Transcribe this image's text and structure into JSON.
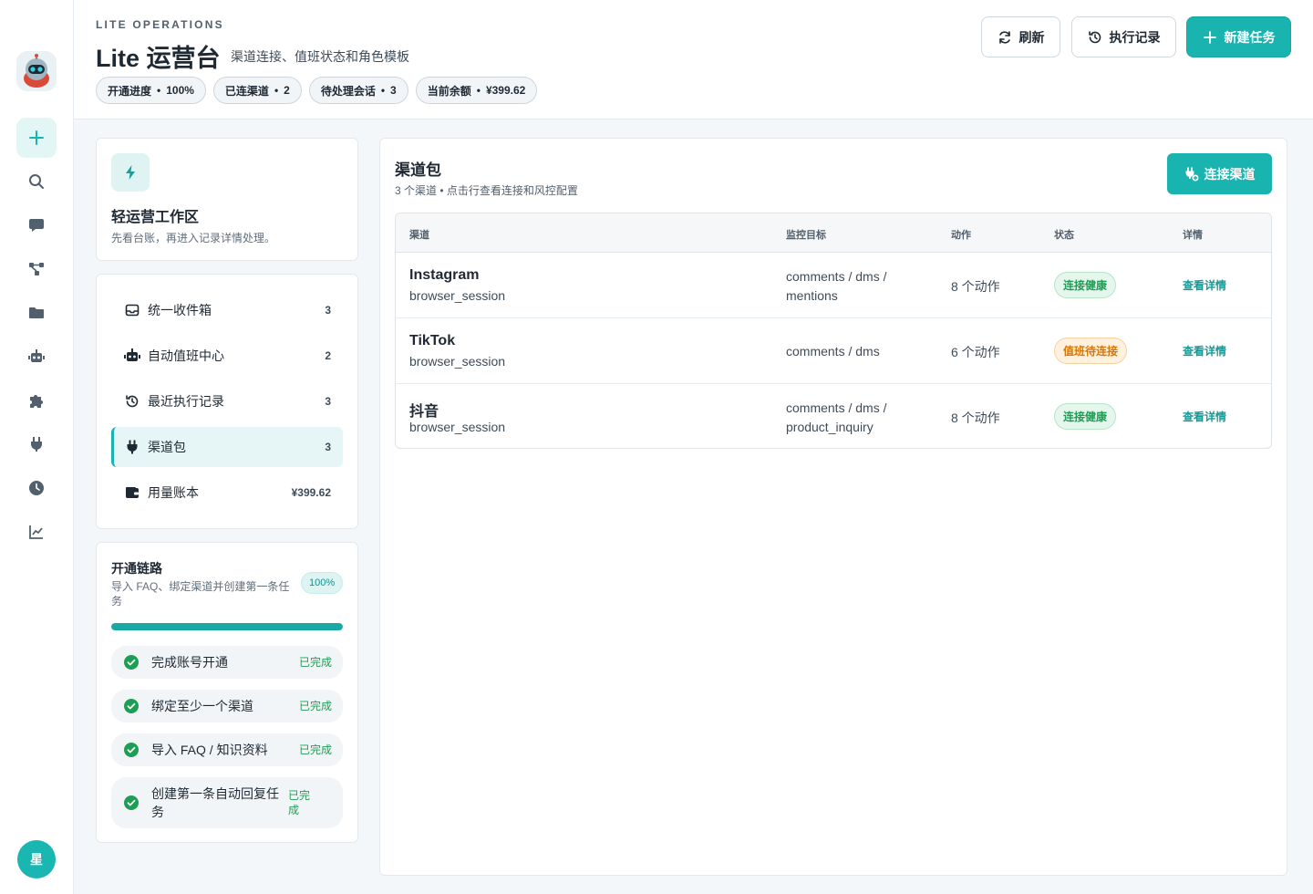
{
  "rail": {
    "icons": [
      "robot-logo",
      "plus-icon",
      "search-icon",
      "chat-icon",
      "flow-icon",
      "folder-icon",
      "bot-icon",
      "puzzle-icon",
      "plug-icon",
      "clock-icon",
      "chart-icon"
    ],
    "avatar": "星"
  },
  "header": {
    "kicker": "LITE OPERATIONS",
    "title": "Lite 运营台",
    "subtitle": "渠道连接、值班状态和角色模板",
    "chips": [
      {
        "label": "开通进度",
        "value": "100%"
      },
      {
        "label": "已连渠道",
        "value": "2"
      },
      {
        "label": "待处理会话",
        "value": "3"
      },
      {
        "label": "当前余额",
        "value": "¥399.62"
      }
    ],
    "separator": "•",
    "refresh": "刷新",
    "history": "执行记录",
    "new_task": "新建任务"
  },
  "workspace": {
    "title": "轻运营工作区",
    "subtitle": "先看台账，再进入记录详情处理。"
  },
  "nav": [
    {
      "label": "统一收件箱",
      "count": "3",
      "icon": "inbox-icon"
    },
    {
      "label": "自动值班中心",
      "count": "2",
      "icon": "robot-icon"
    },
    {
      "label": "最近执行记录",
      "count": "3",
      "icon": "history-icon"
    },
    {
      "label": "渠道包",
      "count": "3",
      "icon": "plug-icon"
    },
    {
      "label": "用量账本",
      "count": "¥399.62",
      "icon": "wallet-icon"
    }
  ],
  "onboarding": {
    "title": "开通链路",
    "subtitle": "导入 FAQ、绑定渠道并创建第一条任务",
    "percent": "100%",
    "progress": 1.0,
    "steps": [
      {
        "label": "完成账号开通",
        "status": "已完成"
      },
      {
        "label": "绑定至少一个渠道",
        "status": "已完成"
      },
      {
        "label": "导入 FAQ / 知识资料",
        "status": "已完成"
      },
      {
        "label": "创建第一条自动回复任务",
        "status": "已完成"
      }
    ]
  },
  "panel": {
    "title": "渠道包",
    "subtitle": "3 个渠道 • 点击行查看连接和风控配置",
    "connect": "连接渠道",
    "columns": [
      "渠道",
      "监控目标",
      "动作",
      "状态",
      "详情"
    ],
    "rows": [
      {
        "name": "Instagram",
        "type": "browser_session",
        "target": "comments / dms / mentions",
        "actions": "8 个动作",
        "status": "连接健康",
        "status_kind": "ok",
        "link": "查看详情"
      },
      {
        "name": "TikTok",
        "type": "browser_session",
        "target": "comments / dms",
        "actions": "6 个动作",
        "status": "值班待连接",
        "status_kind": "warn",
        "link": "查看详情"
      },
      {
        "name": "抖音",
        "type": "browser_session",
        "target": "comments / dms / product_inquiry",
        "actions": "8 个动作",
        "status": "连接健康",
        "status_kind": "ok",
        "link": "查看详情"
      }
    ]
  },
  "colors": {
    "accent": "#19b3b0",
    "success": "#1f9d55",
    "warning": "#d97706"
  }
}
